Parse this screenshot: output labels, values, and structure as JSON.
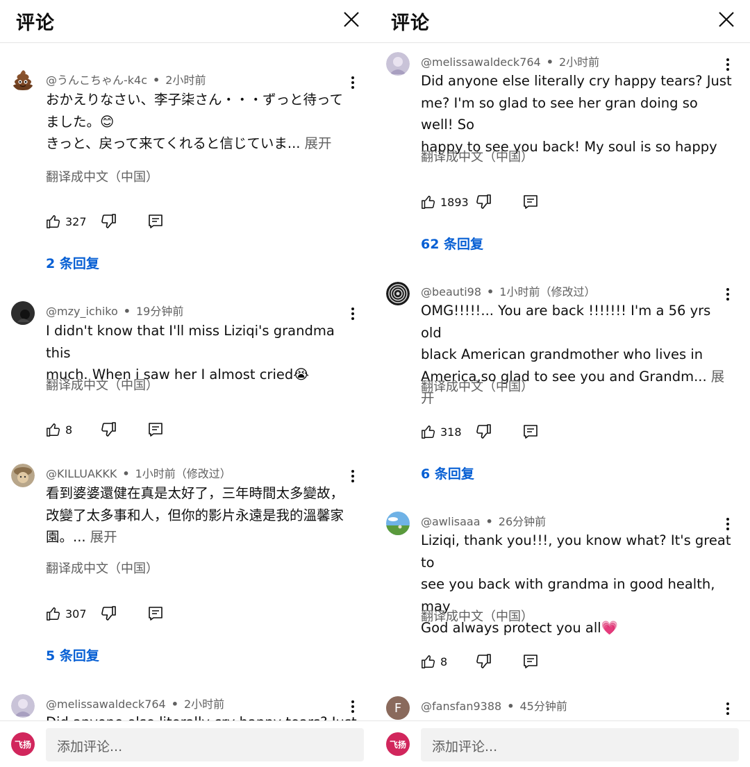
{
  "left": {
    "title": "评论",
    "comments": [
      {
        "handle": "@うんこちゃん-k4c",
        "time": "2小时前",
        "lines": [
          "おかえりなさい、李子柒さん・・・ずっと待って",
          "ました。😊",
          "きっと、戻って来てくれると信じていま..."
        ],
        "expand": "展开",
        "translate": "翻译成中文（中国）",
        "likes": "327",
        "replies": "2 条回复"
      },
      {
        "handle": "@mzy_ichiko",
        "time": "19分钟前",
        "lines": [
          "I didn't know that I'll miss Liziqi's grandma this",
          "much. When i saw her I almost cried😭"
        ],
        "expand": "",
        "translate": "翻译成中文（中国）",
        "likes": "8",
        "replies": ""
      },
      {
        "handle": "@KILLUAKKK",
        "time": "1小时前（修改过）",
        "lines": [
          "看到婆婆還健在真是太好了，三年時間太多變故，",
          "改變了太多事和人，但你的影片永遠是我的溫馨家",
          "園。..."
        ],
        "expand": "展开",
        "translate": "翻译成中文（中国）",
        "likes": "307",
        "replies": "5 条回复"
      },
      {
        "handle": "@melissawaldeck764",
        "time": "2小时前",
        "lines": [
          "Did anyone else literally cry happy tears? Just"
        ]
      }
    ],
    "add_comment_placeholder": "添加评论...",
    "self_avatar_text": "飞扬"
  },
  "right": {
    "title": "评论",
    "comments": [
      {
        "handle": "@melissawaldeck764",
        "time": "2小时前",
        "lines": [
          "Did anyone else literally cry happy tears? Just",
          "me? I'm so glad to see her gran doing so well! So",
          "happy to see you back! My soul is so happy"
        ],
        "expand": "",
        "translate": "翻译成中文（中国）",
        "likes": "1893",
        "replies": "62 条回复"
      },
      {
        "handle": "@beauti98",
        "time": "1小时前（修改过）",
        "lines": [
          "OMG!!!!!... You are back !!!!!!! I'm a 56 yrs old",
          "black American grandmother who lives in",
          "America,so glad to see you and  Grandm..."
        ],
        "expand": "展开",
        "translate": "翻译成中文（中国）",
        "likes": "318",
        "replies": "6 条回复"
      },
      {
        "handle": "@awlisaaa",
        "time": "26分钟前",
        "lines": [
          "Liziqi, thank you!!!, you know what? It's great to",
          "see you back with grandma in good health, may",
          "God always protect you all💗"
        ],
        "expand": "",
        "translate": "翻译成中文（中国）",
        "likes": "8",
        "replies": ""
      },
      {
        "handle": "@fansfan9388",
        "time": "45分钟前",
        "avatar_letter": "F",
        "lines": [
          ""
        ]
      }
    ],
    "add_comment_placeholder": "添加评论...",
    "self_avatar_text": "飞扬"
  }
}
